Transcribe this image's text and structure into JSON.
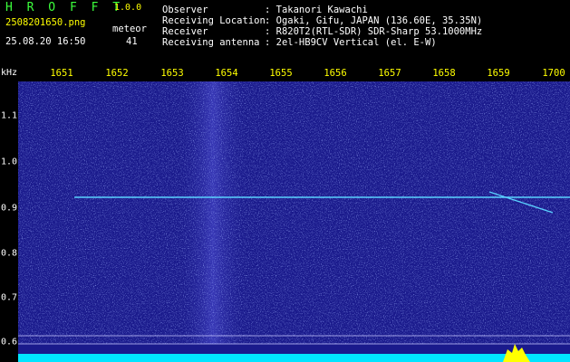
{
  "header": {
    "app_title": "H R O F F T",
    "version": "1.0.0",
    "filename": "2508201650.png",
    "datetime": "25.08.20 16:50",
    "meteor_label": "meteor",
    "meteor_count": "41",
    "info": [
      {
        "label": "Observer",
        "value": ": Takanori Kawachi"
      },
      {
        "label": "Receiving Location",
        "value": ": Ogaki, Gifu, JAPAN (136.60E, 35.35N)"
      },
      {
        "label": "Receiver",
        "value": ": R820T2(RTL-SDR) SDR-Sharp 53.1000MHz"
      },
      {
        "label": "Receiving antenna",
        "value": ": 2el-HB9CV Vertical (el. E-W)"
      }
    ]
  },
  "x_axis": {
    "unit": "kHz",
    "ticks": [
      "1651",
      "1652",
      "1653",
      "1654",
      "1655",
      "1656",
      "1657",
      "1658",
      "1659",
      "1700"
    ]
  },
  "y_axis": {
    "ticks": [
      "1.1",
      "1.0",
      "0.9",
      "0.8",
      "0.7",
      "0.6"
    ]
  },
  "colors": {
    "background": "#1a1a8c",
    "signal": "#5ad2ff",
    "baseline": "#00e5ff",
    "peak": "#ffff00"
  }
}
